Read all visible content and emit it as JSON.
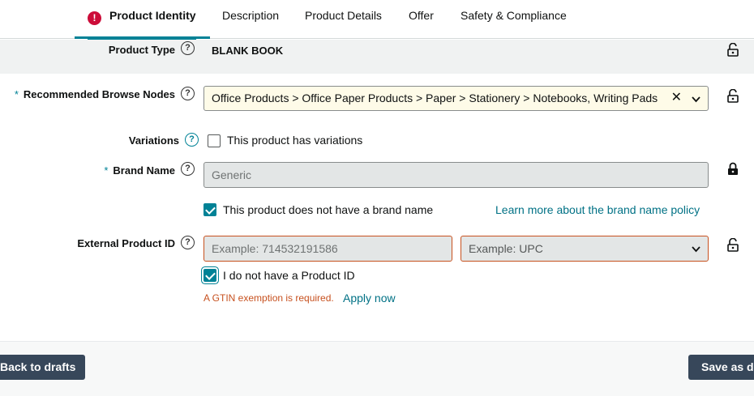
{
  "tabs": [
    {
      "label": "Product Identity",
      "active": true,
      "has_error": true
    },
    {
      "label": "Description"
    },
    {
      "label": "Product Details"
    },
    {
      "label": "Offer"
    },
    {
      "label": "Safety & Compliance"
    }
  ],
  "error_icon": "!",
  "help_glyph": "?",
  "product_type": {
    "label": "Product Type",
    "value": "BLANK BOOK"
  },
  "browse_nodes": {
    "required_mark": "*",
    "label": "Recommended Browse Nodes",
    "value": "Office Products > Office Paper Products > Paper > Stationery > Notebooks, Writing Pads",
    "clear_glyph": "✕",
    "chevron_glyph": "⌄"
  },
  "variations": {
    "label": "Variations",
    "checkbox_label": "This product has variations",
    "checked": false
  },
  "brand_name": {
    "required_mark": "*",
    "label": "Brand Name",
    "placeholder": "Generic",
    "no_brand_label": "This product does not have a brand name",
    "no_brand_checked": true,
    "policy_link": "Learn more about the brand name policy"
  },
  "external_id": {
    "label": "External Product ID",
    "id_placeholder": "Example: 714532191586",
    "type_placeholder": "Example: UPC",
    "no_id_label": "I do not have a Product ID",
    "no_id_checked": true,
    "error": "A GTIN exemption is required.",
    "apply_link": "Apply now"
  },
  "footer": {
    "back_label": "Back to drafts",
    "save_label": "Save as draft"
  },
  "colors": {
    "accent": "#008296",
    "error": "#c7511f",
    "button": "#37475a"
  }
}
